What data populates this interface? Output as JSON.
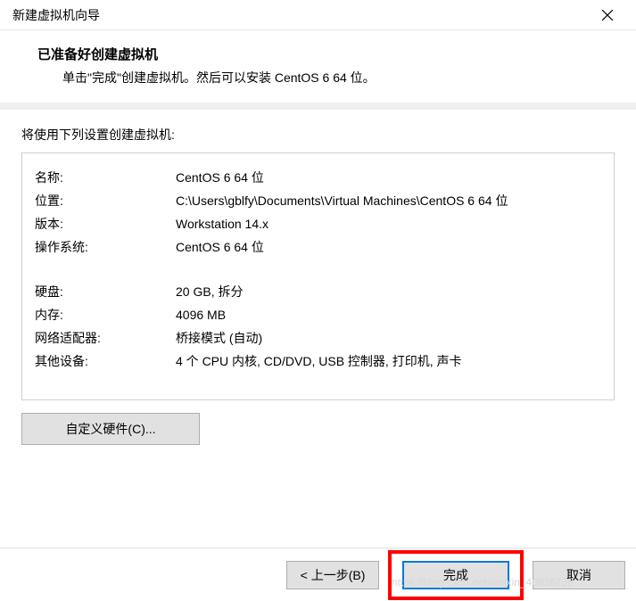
{
  "titlebar": {
    "title": "新建虚拟机向导"
  },
  "header": {
    "title": "已准备好创建虚拟机",
    "description": "单击\"完成\"创建虚拟机。然后可以安装 CentOS 6 64 位。"
  },
  "settings": {
    "intro": "将使用下列设置创建虚拟机:",
    "rows": [
      {
        "key": "名称:",
        "value": "CentOS 6 64 位"
      },
      {
        "key": "位置:",
        "value": "C:\\Users\\gblfy\\Documents\\Virtual Machines\\CentOS 6 64 位"
      },
      {
        "key": "版本:",
        "value": "Workstation 14.x"
      },
      {
        "key": "操作系统:",
        "value": "CentOS 6 64 位"
      }
    ],
    "rows2": [
      {
        "key": "硬盘:",
        "value": "20 GB, 拆分"
      },
      {
        "key": "内存:",
        "value": "4096 MB"
      },
      {
        "key": "网络适配器:",
        "value": "桥接模式 (自动)"
      },
      {
        "key": "其他设备:",
        "value": "4 个 CPU 内核, CD/DVD, USB 控制器, 打印机, 声卡"
      }
    ]
  },
  "buttons": {
    "customize": "自定义硬件(C)...",
    "back": "< 上一步(B)",
    "finish": "完成",
    "cancel": "取消"
  },
  "watermark": "https://blog.csdn.net/weixin_40816738"
}
